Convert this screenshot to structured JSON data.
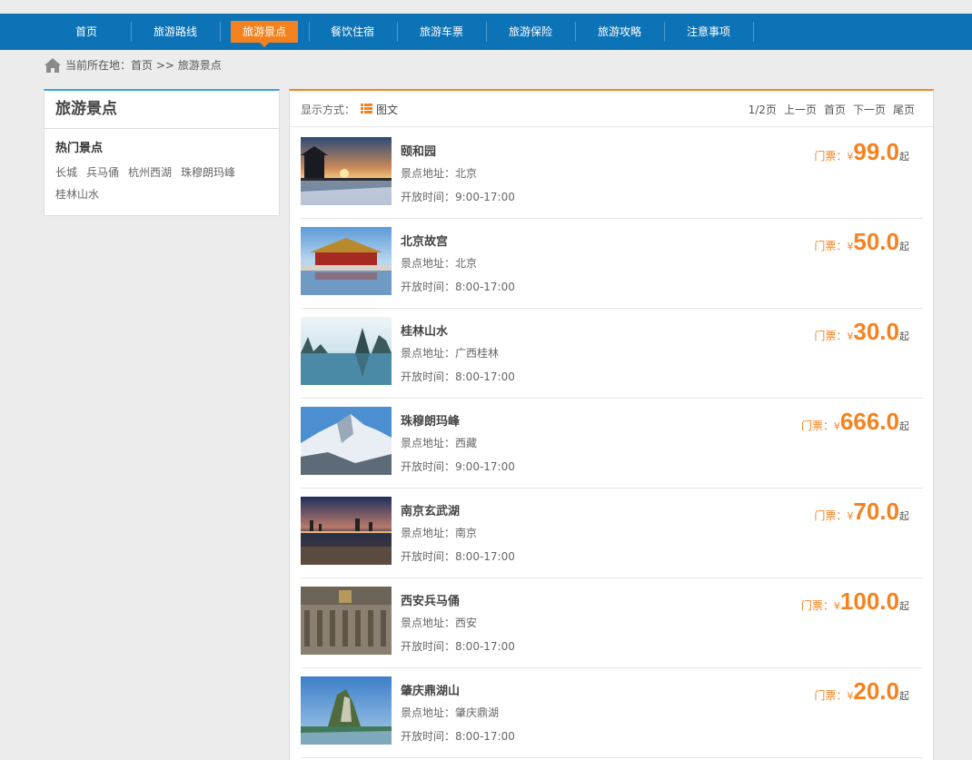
{
  "nav": {
    "items": [
      {
        "label": "首页"
      },
      {
        "label": "旅游路线"
      },
      {
        "label": "旅游景点",
        "active": true
      },
      {
        "label": "餐饮住宿"
      },
      {
        "label": "旅游车票"
      },
      {
        "label": "旅游保险"
      },
      {
        "label": "旅游攻略"
      },
      {
        "label": "注意事项"
      }
    ],
    "bg_color": "#0d73b7",
    "active_color": "#f5821f"
  },
  "breadcrumb": {
    "text": "当前所在地：首页 >> 旅游景点",
    "icon": "home-icon"
  },
  "sidebar": {
    "title": "旅游景点",
    "subtitle": "热门景点",
    "tags": [
      "长城",
      "兵马俑",
      "杭州西湖",
      "珠穆朗玛峰",
      "桂林山水"
    ]
  },
  "toolbar": {
    "mode_label": "显示方式：",
    "mode_text": "图文",
    "mode_icon": "list-icon"
  },
  "pager": {
    "info": "1/2页",
    "prev": "上一页",
    "first": "首页",
    "next": "下一页",
    "last": "尾页"
  },
  "list": [
    {
      "name": "颐和园",
      "addr": "景点地址：北京",
      "time": "开放时间：9:00-17:00",
      "price_label": "门票：",
      "currency": "¥",
      "price": "99.0",
      "suffix": "起",
      "thumb": "summer-palace-sunset"
    },
    {
      "name": "北京故宫",
      "addr": "景点地址：北京",
      "time": "开放时间：8:00-17:00",
      "price_label": "门票：",
      "currency": "¥",
      "price": "50.0",
      "suffix": "起",
      "thumb": "forbidden-city"
    },
    {
      "name": "桂林山水",
      "addr": "景点地址：广西桂林",
      "time": "开放时间：8:00-17:00",
      "price_label": "门票：",
      "currency": "¥",
      "price": "30.0",
      "suffix": "起",
      "thumb": "guilin-karst"
    },
    {
      "name": "珠穆朗玛峰",
      "addr": "景点地址：西藏",
      "time": "开放时间：9:00-17:00",
      "price_label": "门票：",
      "currency": "¥",
      "price": "666.0",
      "suffix": "起",
      "thumb": "everest-snow"
    },
    {
      "name": "南京玄武湖",
      "addr": "景点地址：南京",
      "time": "开放时间：8:00-17:00",
      "price_label": "门票：",
      "currency": "¥",
      "price": "70.0",
      "suffix": "起",
      "thumb": "xuanwu-lake-dusk"
    },
    {
      "name": "西安兵马俑",
      "addr": "景点地址：西安",
      "time": "开放时间：8:00-17:00",
      "price_label": "门票：",
      "currency": "¥",
      "price": "100.0",
      "suffix": "起",
      "thumb": "terracotta-warriors"
    },
    {
      "name": "肇庆鼎湖山",
      "addr": "景点地址：肇庆鼎湖",
      "time": "开放时间：8:00-17:00",
      "price_label": "门票：",
      "currency": "¥",
      "price": "20.0",
      "suffix": "起",
      "thumb": "dinghu-mountain"
    }
  ]
}
